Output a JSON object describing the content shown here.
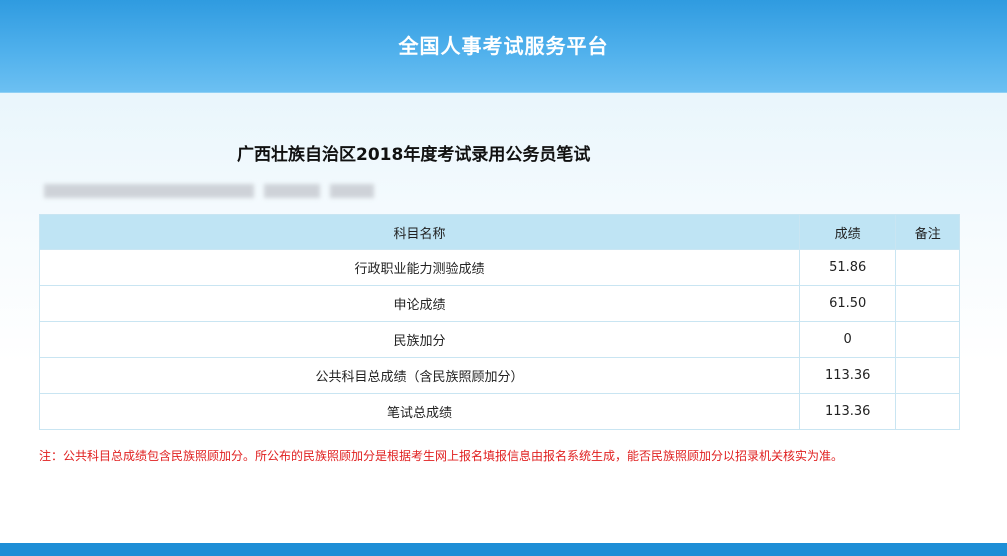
{
  "header": {
    "title": "全国人事考试服务平台"
  },
  "exam": {
    "title": "广西壮族自治区2018年度考试录用公务员笔试"
  },
  "table": {
    "headers": {
      "subject": "科目名称",
      "score": "成绩",
      "note": "备注"
    },
    "rows": [
      {
        "subject": "行政职业能力测验成绩",
        "score": "51.86",
        "note": ""
      },
      {
        "subject": "申论成绩",
        "score": "61.50",
        "note": ""
      },
      {
        "subject": "民族加分",
        "score": "0",
        "note": ""
      },
      {
        "subject": "公共科目总成绩（含民族照顾加分）",
        "score": "113.36",
        "note": ""
      },
      {
        "subject": "笔试总成绩",
        "score": "113.36",
        "note": ""
      }
    ]
  },
  "note": "注：公共科目总成绩包含民族照顾加分。所公布的民族照顾加分是根据考生网上报名填报信息由报名系统生成，能否民族照顾加分以招录机关核实为准。",
  "colors": {
    "header_blue": "#2f9be0",
    "table_header": "#bfe4f4",
    "note_red": "#e02020"
  }
}
